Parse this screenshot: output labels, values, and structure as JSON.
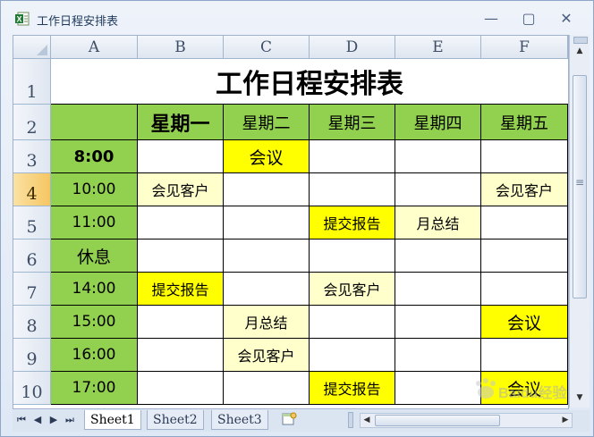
{
  "window": {
    "title": "工作日程安排表",
    "minimize_glyph": "—",
    "restore_glyph": "▢",
    "close_glyph": "✕"
  },
  "columns": [
    "A",
    "B",
    "C",
    "D",
    "E",
    "F"
  ],
  "rows": [
    "1",
    "2",
    "3",
    "4",
    "5",
    "6",
    "7",
    "8",
    "9",
    "10"
  ],
  "selected_row": "4",
  "sheet": {
    "title": "工作日程安排表",
    "days": [
      "星期一",
      "星期二",
      "星期三",
      "星期四",
      "星期五"
    ],
    "schedule": [
      {
        "time": "8:00",
        "cells": [
          "",
          "会议",
          "",
          "",
          ""
        ]
      },
      {
        "time": "10:00",
        "cells": [
          "会见客户",
          "",
          "",
          "",
          "会见客户"
        ]
      },
      {
        "time": "11:00",
        "cells": [
          "",
          "",
          "提交报告",
          "月总结",
          ""
        ]
      },
      {
        "time": "休息",
        "cells": [
          "",
          "",
          "",
          "",
          ""
        ]
      },
      {
        "time": "14:00",
        "cells": [
          "提交报告",
          "",
          "会见客户",
          "",
          ""
        ]
      },
      {
        "time": "15:00",
        "cells": [
          "",
          "月总结",
          "",
          "",
          "会议"
        ]
      },
      {
        "time": "16:00",
        "cells": [
          "",
          "会见客户",
          "",
          "",
          ""
        ]
      },
      {
        "time": "17:00",
        "cells": [
          "",
          "",
          "提交报告",
          "",
          "会议"
        ]
      }
    ]
  },
  "tabs": [
    "Sheet1",
    "Sheet2",
    "Sheet3"
  ],
  "active_tab": "Sheet1",
  "watermark_text": "Baidu经验",
  "colors": {
    "header_green": "#92d050",
    "meeting_yellow": "#ffff00",
    "pale_yellow": "#ffffcc",
    "selected_row_header": "#f5c662"
  }
}
